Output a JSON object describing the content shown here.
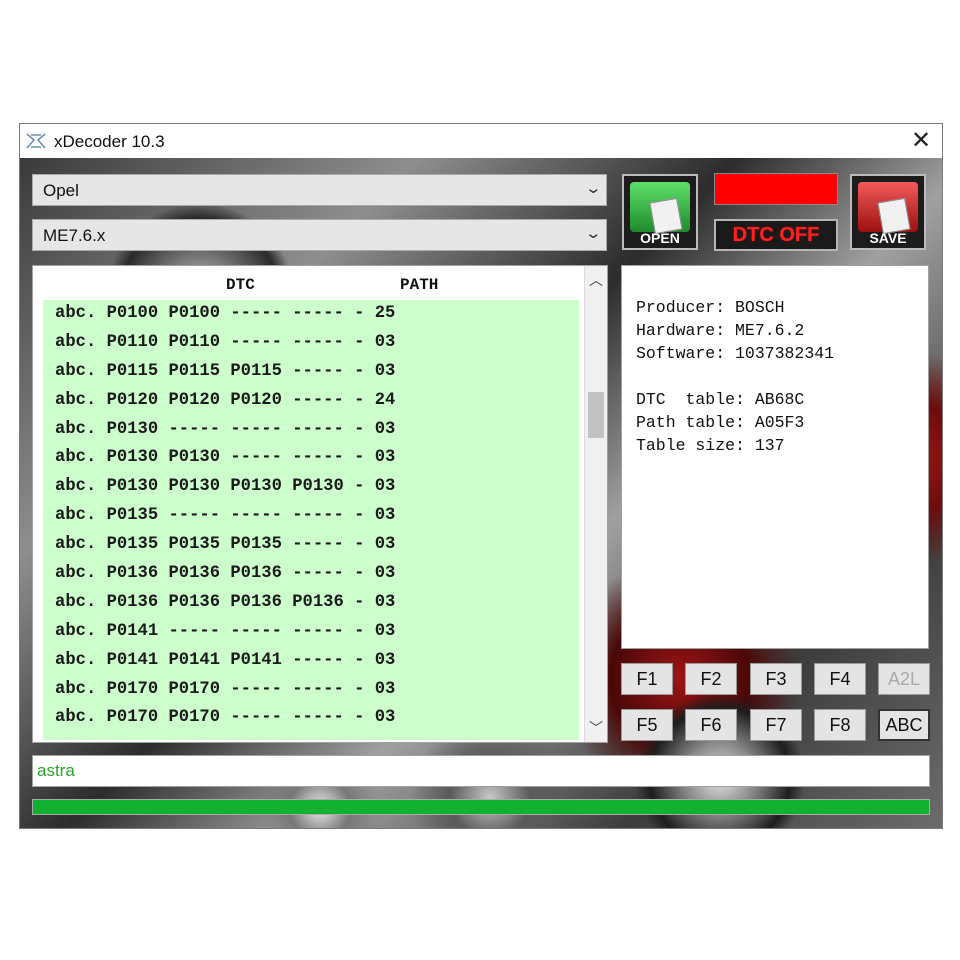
{
  "window": {
    "title": "xDecoder 10.3",
    "close_icon": "close-icon"
  },
  "selectors": {
    "manufacturer": "Opel",
    "ecu": "ME7.6.x"
  },
  "toolbar": {
    "open_label": "OPEN",
    "save_label": "SAVE",
    "dtc_off_label": "DTC OFF",
    "indicator_color": "#ff0000"
  },
  "dtc_list": {
    "headers": {
      "dtc": "DTC",
      "path": "PATH"
    },
    "rows": [
      "abc. P0100 P0100 ----- ----- - 25",
      "abc. P0110 P0110 ----- ----- - 03",
      "abc. P0115 P0115 P0115 ----- - 03",
      "abc. P0120 P0120 P0120 ----- - 24",
      "abc. P0130 ----- ----- ----- - 03",
      "abc. P0130 P0130 ----- ----- - 03",
      "abc. P0130 P0130 P0130 P0130 - 03",
      "abc. P0135 ----- ----- ----- - 03",
      "abc. P0135 P0135 P0135 ----- - 03",
      "abc. P0136 P0136 P0136 ----- - 03",
      "abc. P0136 P0136 P0136 P0136 - 03",
      "abc. P0141 ----- ----- ----- - 03",
      "abc. P0141 P0141 P0141 ----- - 03",
      "abc. P0170 P0170 ----- ----- - 03",
      "abc. P0170 P0170 ----- ----- - 03"
    ]
  },
  "info": {
    "producer": "Producer: BOSCH",
    "hardware": "Hardware: ME7.6.2",
    "software": "Software: 1037382341",
    "dtc_table": "DTC  table: AB68C",
    "path_table": "Path table: A05F3",
    "table_size": "Table size: 137"
  },
  "function_keys": {
    "row1": [
      "F1",
      "F2",
      "F3",
      "F4",
      "A2L"
    ],
    "row2": [
      "F5",
      "F6",
      "F7",
      "F8",
      "ABC"
    ]
  },
  "status": {
    "text": "astra"
  },
  "progress": {
    "fraction": 1.0,
    "color": "#10b030"
  }
}
